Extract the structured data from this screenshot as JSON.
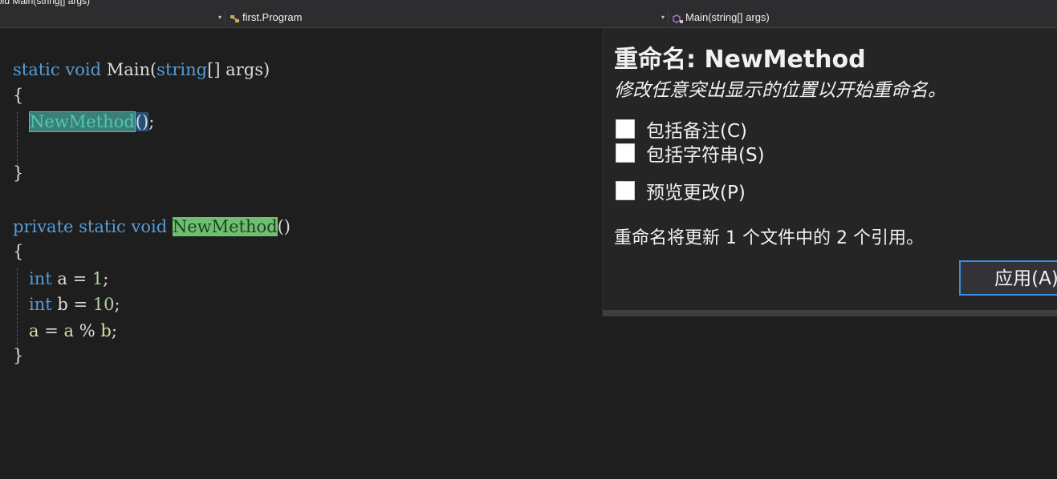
{
  "tab_strip": {
    "text": "oid Main(string[] args)"
  },
  "navbar": {
    "project_value": "",
    "type_value": "first.Program",
    "member_value": "Main(string[] args)"
  },
  "code": {
    "line1": {
      "k1": "static",
      "k2": "void",
      "name": "Main",
      "p1": "(",
      "k3": "string",
      "rest": "[] args)"
    },
    "line2": "{",
    "line3": {
      "call": "NewMethod",
      "parens": "()",
      "semi": ";"
    },
    "line4": "}",
    "line5": {
      "k1": "private",
      "k2": "static",
      "k3": "void",
      "name": "NewMethod",
      "parens": "()"
    },
    "line6": "{",
    "line7": {
      "kw": "int",
      "var": "a",
      "op": " = ",
      "num": "1",
      "semi": ";"
    },
    "line8": {
      "kw": "int",
      "var": "b",
      "op": " = ",
      "num": "10",
      "semi": ";"
    },
    "line9": {
      "v1": "a",
      "op1": " = ",
      "v2": "a",
      "op2": " % ",
      "v3": "b",
      "semi": ";"
    },
    "line10": "}"
  },
  "rename_panel": {
    "title": "重命名: NewMethod",
    "subtitle": "修改任意突出显示的位置以开始重命名。",
    "options": [
      {
        "label": "包括备注(C)",
        "checked": false
      },
      {
        "label": "包括字符串(S)",
        "checked": false
      },
      {
        "label": "预览更改(P)",
        "checked": false
      }
    ],
    "info": "重命名将更新 1 个文件中的 2 个引用。",
    "apply_label": "应用(A)"
  },
  "colors": {
    "keyword": "#569cd6",
    "method": "#dcdcaa",
    "number": "#b5cea8",
    "rename_highlight": "#3b7e7a",
    "reference_highlight": "#6fbf72",
    "button_border": "#3c8ce0"
  }
}
